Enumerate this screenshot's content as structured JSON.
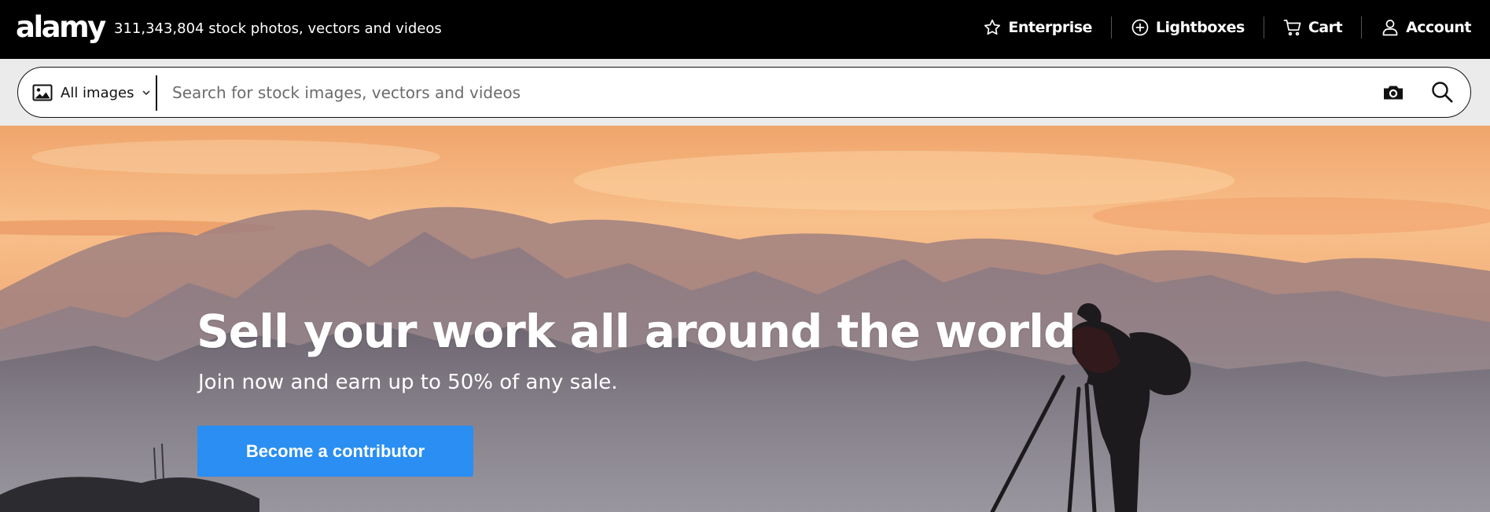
{
  "header": {
    "logo_text": "alamy",
    "tagline": "311,343,804 stock photos, vectors and videos",
    "nav": [
      {
        "label": "Enterprise",
        "icon": "star-icon"
      },
      {
        "label": "Lightboxes",
        "icon": "plus-circle-icon"
      },
      {
        "label": "Cart",
        "icon": "cart-icon"
      },
      {
        "label": "Account",
        "icon": "user-icon"
      }
    ]
  },
  "search": {
    "scope_label": "All images",
    "scope_icon": "image-icon",
    "placeholder": "Search for stock images, vectors and videos",
    "camera_icon": "camera-search-icon",
    "search_icon": "search-icon"
  },
  "hero": {
    "title": "Sell your work all around the world",
    "subtitle": "Join now and earn up to 50% of any sale.",
    "cta_label": "Become a contributor"
  },
  "colors": {
    "topbar_bg": "#000000",
    "search_band_bg": "#ebebeb",
    "cta_bg": "#2a8ef2",
    "sky_orange": "#f6b985"
  }
}
